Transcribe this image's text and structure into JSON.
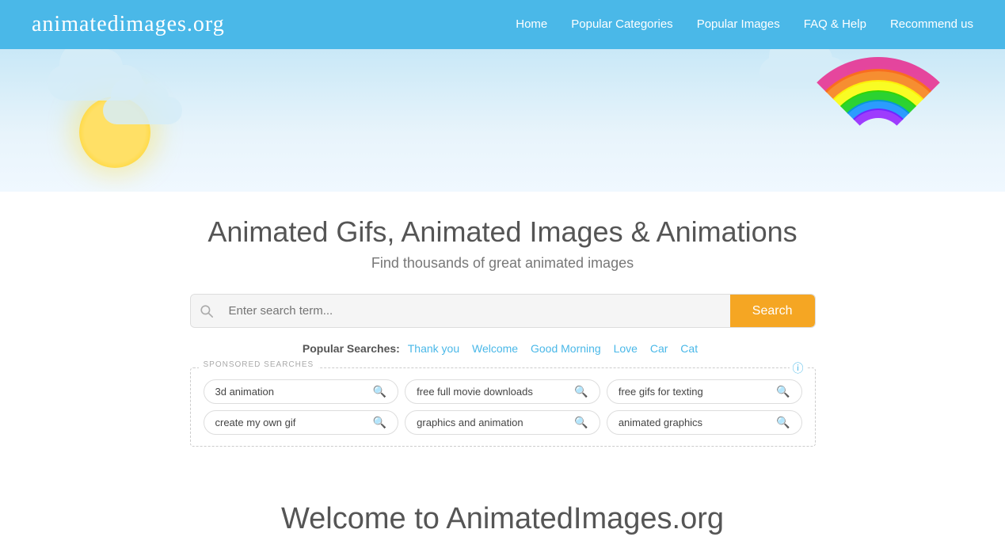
{
  "navbar": {
    "logo": "animatedimages.org",
    "links": [
      {
        "id": "home",
        "label": "Home"
      },
      {
        "id": "popular-categories",
        "label": "Popular Categories"
      },
      {
        "id": "popular-images",
        "label": "Popular Images"
      },
      {
        "id": "faq-help",
        "label": "FAQ & Help"
      },
      {
        "id": "recommend-us",
        "label": "Recommend us"
      }
    ]
  },
  "hero": {
    "title": "Animated Gifs, Animated Images & Animations",
    "subtitle": "Find thousands of great animated images"
  },
  "search": {
    "placeholder": "Enter search term...",
    "button_label": "Search"
  },
  "popular_searches": {
    "label": "Popular Searches:",
    "links": [
      {
        "id": "thank-you",
        "label": "Thank you"
      },
      {
        "id": "welcome",
        "label": "Welcome"
      },
      {
        "id": "good-morning",
        "label": "Good Morning"
      },
      {
        "id": "love",
        "label": "Love"
      },
      {
        "id": "car",
        "label": "Car"
      },
      {
        "id": "cat",
        "label": "Cat"
      }
    ]
  },
  "sponsored": {
    "label": "SPONSORED SEARCHES",
    "items": [
      {
        "id": "3d-animation",
        "label": "3d animation"
      },
      {
        "id": "free-full-movie-downloads",
        "label": "free full movie downloads"
      },
      {
        "id": "free-gifs-for-texting",
        "label": "free gifs for texting"
      },
      {
        "id": "create-my-own-gif",
        "label": "create my own gif"
      },
      {
        "id": "graphics-and-animation",
        "label": "graphics and animation"
      },
      {
        "id": "animated-graphics",
        "label": "animated graphics"
      }
    ]
  },
  "welcome": {
    "title": "Welcome to AnimatedImages.org"
  }
}
